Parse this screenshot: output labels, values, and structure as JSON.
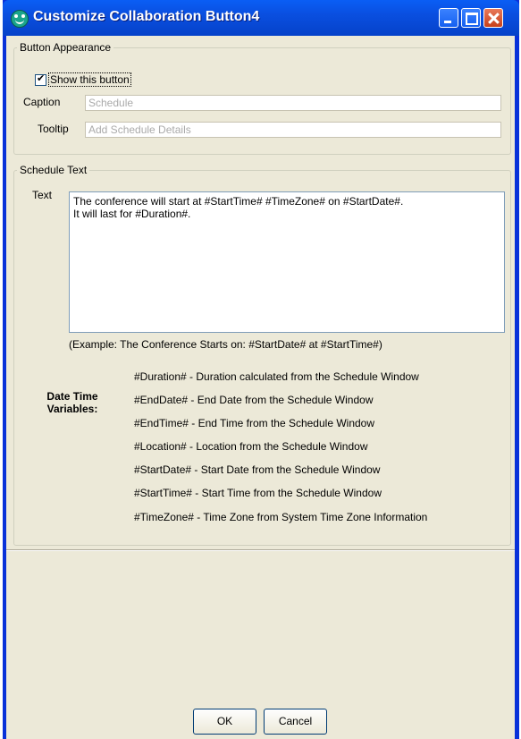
{
  "window": {
    "title": "Customize Collaboration Button4"
  },
  "button_appearance": {
    "legend": "Button Appearance",
    "show_button_label": "Show this button",
    "show_button_checked": true,
    "caption_label": "Caption",
    "caption_value": "Schedule",
    "tooltip_label": "Tooltip",
    "tooltip_value": "Add Schedule Details"
  },
  "schedule_text": {
    "legend": "Schedule Text",
    "text_label": "Text",
    "text_value": "The conference will start at #StartTime# #TimeZone# on #StartDate#.\nIt will last for #Duration#.",
    "example": "(Example: The Conference Starts on: #StartDate# at #StartTime#)",
    "variables_heading": "Date Time Variables:",
    "variables": [
      "#Duration# - Duration calculated from the Schedule Window",
      "#EndDate# - End Date from the Schedule Window",
      "#EndTime# - End Time from the Schedule Window",
      "#Location# - Location from the Schedule Window",
      "#StartDate# - Start Date from the Schedule Window",
      "#StartTime# - Start Time from the Schedule Window",
      "#TimeZone# - Time Zone from System Time Zone Information"
    ]
  },
  "buttons": {
    "ok": "OK",
    "cancel": "Cancel"
  },
  "icons": {
    "app": "collaboration-app-icon",
    "minimize": "minimize-icon",
    "maximize": "maximize-icon",
    "close": "close-icon"
  },
  "colors": {
    "titlebar": "#0a5ef5",
    "client_background": "#ece9d8",
    "close_button": "#c8401a"
  }
}
